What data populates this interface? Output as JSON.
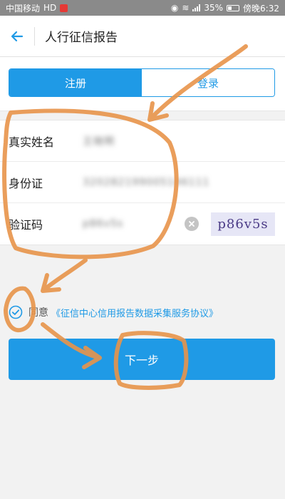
{
  "status_bar": {
    "carrier": "中国移动",
    "hd": "HD",
    "battery": "35%",
    "time": "傍晚6:32"
  },
  "header": {
    "title": "人行征信报告"
  },
  "tabs": [
    {
      "label": "注册",
      "active": true
    },
    {
      "label": "登录",
      "active": false
    }
  ],
  "form": {
    "name": {
      "label": "真实姓名",
      "value": "王晓明"
    },
    "id_card": {
      "label": "身份证",
      "value": "320282199005146111"
    },
    "code": {
      "label": "验证码",
      "value": "p86v5s"
    },
    "captcha_text": "p86v5s"
  },
  "agreement": {
    "prefix": "同意",
    "link": "《征信中心信用报告数据采集服务协议》",
    "checked": true
  },
  "next_button": {
    "label": "下一步"
  },
  "colors": {
    "primary": "#1f9ae6",
    "annotation": "#e8944a",
    "status_bar": "#8a8a8a",
    "page_bg": "#f2f2f2"
  }
}
